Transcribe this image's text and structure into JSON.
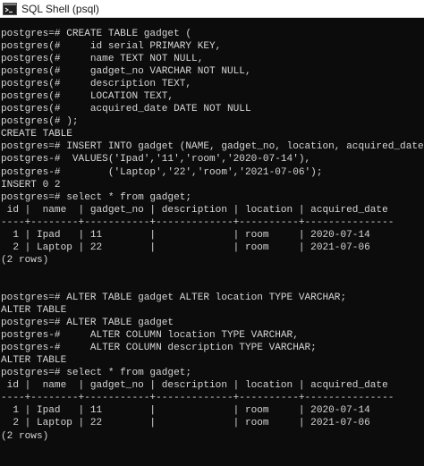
{
  "window": {
    "title": "SQL Shell (psql)",
    "icon": "terminal-icon"
  },
  "console": {
    "lines": [
      "postgres=# CREATE TABLE gadget (",
      "postgres(#     id serial PRIMARY KEY,",
      "postgres(#     name TEXT NOT NULL,",
      "postgres(#     gadget_no VARCHAR NOT NULL,",
      "postgres(#     description TEXT,",
      "postgres(#     LOCATION TEXT,",
      "postgres(#     acquired_date DATE NOT NULL",
      "postgres(# );",
      "CREATE TABLE",
      "postgres=# INSERT INTO gadget (NAME, gadget_no, location, acquired_date)",
      "postgres-#  VALUES('Ipad','11','room','2020-07-14'),",
      "postgres-#        ('Laptop','22','room','2021-07-06');",
      "INSERT 0 2",
      "postgres=# select * from gadget;",
      " id |  name  | gadget_no | description | location | acquired_date",
      "----+--------+-----------+-------------+----------+---------------",
      "  1 | Ipad   | 11        |             | room     | 2020-07-14",
      "  2 | Laptop | 22        |             | room     | 2021-07-06",
      "(2 rows)",
      "",
      "",
      "postgres=# ALTER TABLE gadget ALTER location TYPE VARCHAR;",
      "ALTER TABLE",
      "postgres=# ALTER TABLE gadget",
      "postgres-#     ALTER COLUMN location TYPE VARCHAR,",
      "postgres-#     ALTER COLUMN description TYPE VARCHAR;",
      "ALTER TABLE",
      "postgres=# select * from gadget;",
      " id |  name  | gadget_no | description | location | acquired_date",
      "----+--------+-----------+-------------+----------+---------------",
      "  1 | Ipad   | 11        |             | room     | 2020-07-14",
      "  2 | Laptop | 22        |             | room     | 2021-07-06",
      "(2 rows)"
    ]
  }
}
